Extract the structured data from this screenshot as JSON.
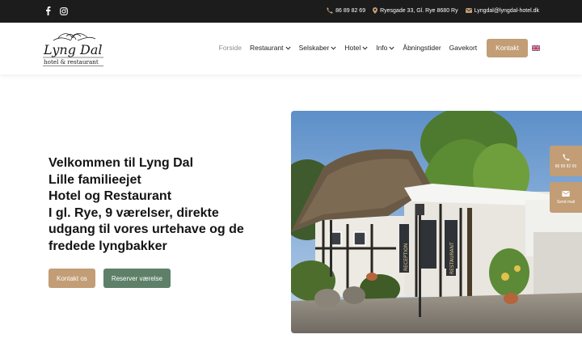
{
  "topbar": {
    "social": [
      "facebook-icon",
      "instagram-icon"
    ],
    "phone": "86 89 82 69",
    "address": "Ryesgade 33, Gl. Rye 8680 Ry",
    "email": "Lyngdal@lyngdal-hotel.dk"
  },
  "logo": {
    "line1": "Lyng Dal",
    "line2": "hotel & restaurant"
  },
  "nav": {
    "items": [
      "Forside",
      "Restaurant",
      "Selskaber",
      "Hotel",
      "Info",
      "Åbningstider",
      "Gavekort"
    ],
    "kontakt": "Kontakt",
    "language": "flag-gb-icon"
  },
  "hero": {
    "lines": [
      "Velkommen til Lyng Dal",
      "Lille familieejet",
      "Hotel og Restaurant",
      "I gl. Rye, 9 værelser, direkte",
      "udgang til vores urtehave og de",
      "fredede lyngbakker"
    ],
    "btn_contact": "Kontakt os",
    "btn_reserve": "Reserver værelse",
    "photo_signs": [
      "RECEPTION",
      "RESTAURANT"
    ]
  },
  "side_widgets": {
    "phone": "86 89 82 69",
    "mail": "Send mail"
  },
  "colors": {
    "accent": "#c29d75",
    "green": "#5e8069",
    "topbar": "#1b1c1b"
  }
}
